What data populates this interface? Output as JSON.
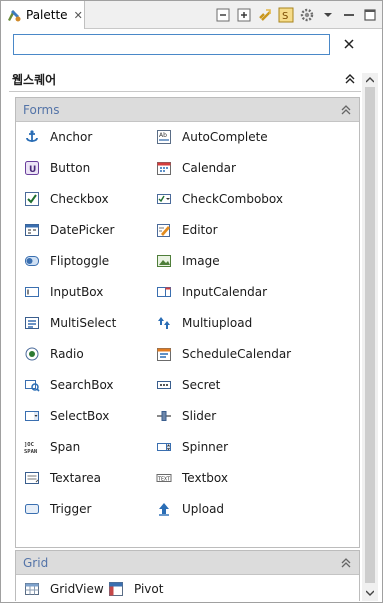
{
  "tab": {
    "label": "Palette",
    "close_glyph": "✕",
    "icon": "palette-icon"
  },
  "toolbar": {
    "icons": [
      "collapse-all-icon",
      "expand-all-icon",
      "link-icon",
      "settings-palette-icon",
      "gear-icon",
      "view-menu-chevron-icon",
      "minimize-icon",
      "maximize-icon"
    ]
  },
  "search": {
    "value": "",
    "placeholder": "",
    "clear_glyph": "✕"
  },
  "root": {
    "title": "웹스퀘어"
  },
  "forms": {
    "title": "Forms",
    "items": [
      {
        "label": "Anchor",
        "icon": "anchor-icon"
      },
      {
        "label": "AutoComplete",
        "icon": "autocomplete-icon"
      },
      {
        "label": "Button",
        "icon": "button-icon"
      },
      {
        "label": "Calendar",
        "icon": "calendar-icon"
      },
      {
        "label": "Checkbox",
        "icon": "checkbox-icon"
      },
      {
        "label": "CheckCombobox",
        "icon": "checkcombobox-icon"
      },
      {
        "label": "DatePicker",
        "icon": "datepicker-icon"
      },
      {
        "label": "Editor",
        "icon": "editor-icon"
      },
      {
        "label": "Fliptoggle",
        "icon": "fliptoggle-icon"
      },
      {
        "label": "Image",
        "icon": "image-icon"
      },
      {
        "label": "InputBox",
        "icon": "inputbox-icon"
      },
      {
        "label": "InputCalendar",
        "icon": "inputcalendar-icon"
      },
      {
        "label": "MultiSelect",
        "icon": "multiselect-icon"
      },
      {
        "label": "Multiupload",
        "icon": "multiupload-icon"
      },
      {
        "label": "Radio",
        "icon": "radio-icon"
      },
      {
        "label": "ScheduleCalendar",
        "icon": "schedulecalendar-icon"
      },
      {
        "label": "SearchBox",
        "icon": "searchbox-icon"
      },
      {
        "label": "Secret",
        "icon": "secret-icon"
      },
      {
        "label": "SelectBox",
        "icon": "selectbox-icon"
      },
      {
        "label": "Slider",
        "icon": "slider-icon"
      },
      {
        "label": "Span",
        "icon": "span-icon"
      },
      {
        "label": "Spinner",
        "icon": "spinner-icon"
      },
      {
        "label": "Textarea",
        "icon": "textarea-icon"
      },
      {
        "label": "Textbox",
        "icon": "textbox-icon"
      },
      {
        "label": "Trigger",
        "icon": "trigger-icon"
      },
      {
        "label": "Upload",
        "icon": "upload-icon"
      }
    ]
  },
  "grid": {
    "title": "Grid",
    "items": [
      {
        "label": "GridView",
        "icon": "gridview-icon"
      },
      {
        "label": "Pivot",
        "icon": "pivot-icon"
      }
    ]
  },
  "colors": {
    "accent": "#5474a8",
    "search_border": "#4a88c8",
    "drawer_header": "#dcdcdc"
  }
}
